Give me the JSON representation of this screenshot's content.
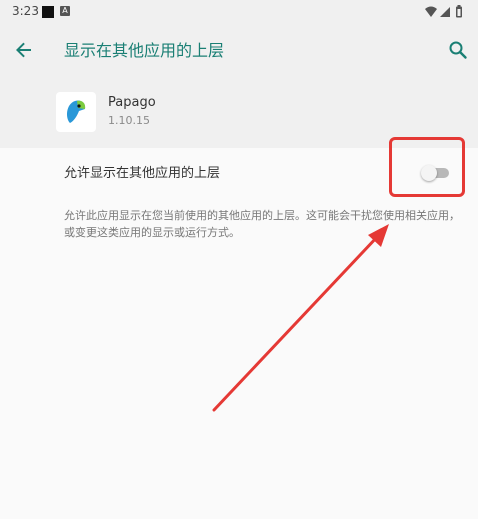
{
  "status_bar": {
    "time": "3:23",
    "notif_letter": "A"
  },
  "app_bar": {
    "title": "显示在其他应用的上层"
  },
  "app": {
    "name": "Papago",
    "version": "1.10.15"
  },
  "setting": {
    "label": "允许显示在其他应用的上层",
    "enabled": false,
    "description": "允许此应用显示在您当前使用的其他应用的上层。这可能会干扰您使用相关应用，或变更这类应用的显示或运行方式。"
  },
  "colors": {
    "accent": "#1a7f74",
    "annotation": "#e53935"
  },
  "icons": {
    "back": "arrow-left-icon",
    "search": "search-icon",
    "wifi": "wifi-icon",
    "signal": "signal-icon",
    "battery": "battery-icon"
  }
}
